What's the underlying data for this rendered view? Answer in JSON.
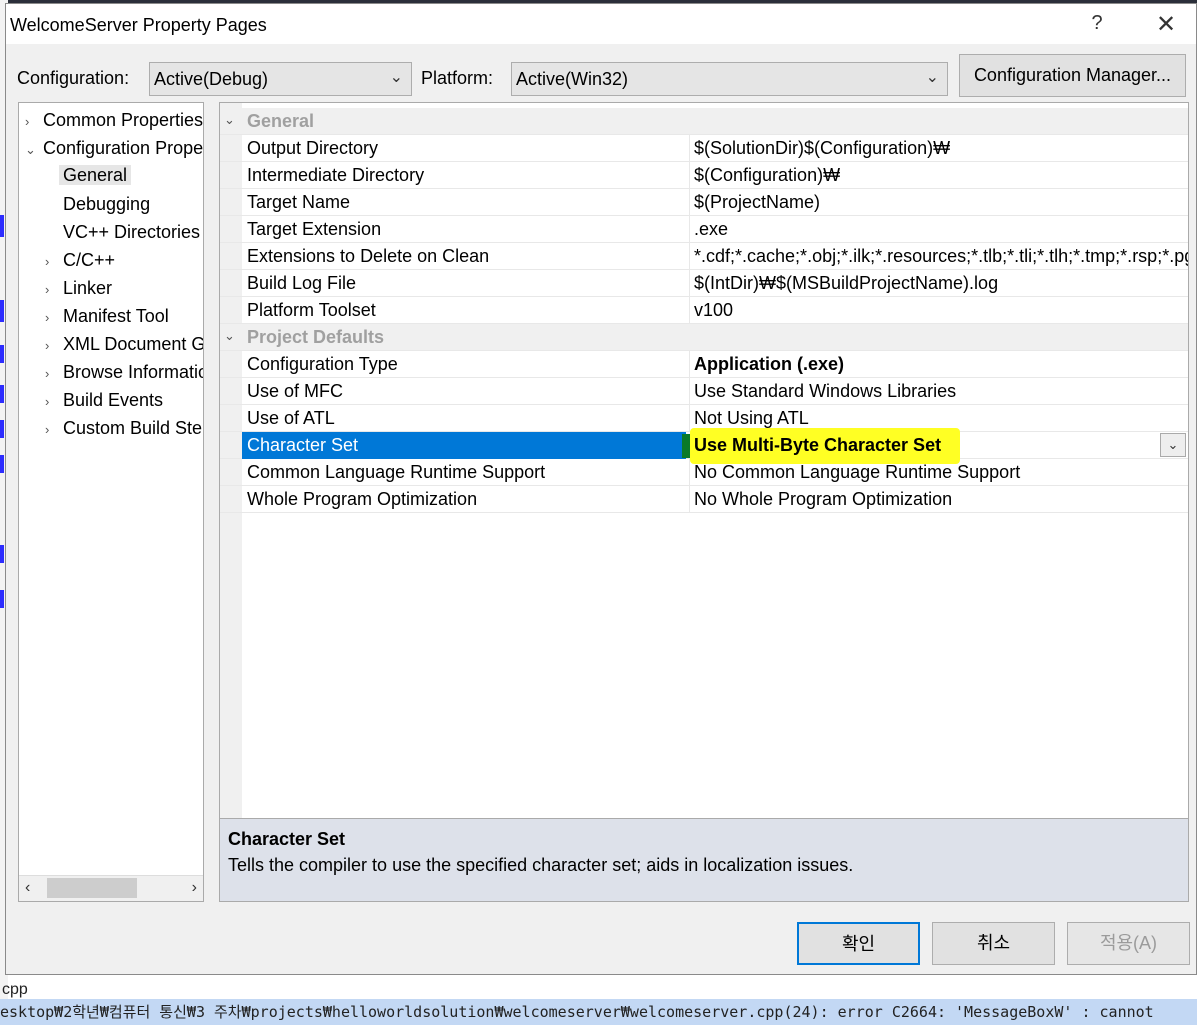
{
  "window": {
    "title": "WelcomeServer Property Pages",
    "help_label": "?",
    "close_label": "✕"
  },
  "toolbar": {
    "configuration_label": "Configuration:",
    "configuration_value": "Active(Debug)",
    "platform_label": "Platform:",
    "platform_value": "Active(Win32)",
    "config_manager_label": "Configuration Manager..."
  },
  "tree": {
    "items": [
      {
        "label": "Common Properties",
        "chevron": "›"
      },
      {
        "label": "Configuration Properties",
        "chevron": "⌄"
      },
      {
        "label": "General",
        "chevron": ""
      },
      {
        "label": "Debugging",
        "chevron": ""
      },
      {
        "label": "VC++ Directories",
        "chevron": ""
      },
      {
        "label": "C/C++",
        "chevron": "›"
      },
      {
        "label": "Linker",
        "chevron": "›"
      },
      {
        "label": "Manifest Tool",
        "chevron": "›"
      },
      {
        "label": "XML Document Generator",
        "chevron": "›"
      },
      {
        "label": "Browse Information",
        "chevron": "›"
      },
      {
        "label": "Build Events",
        "chevron": "›"
      },
      {
        "label": "Custom Build Step",
        "chevron": "›"
      }
    ],
    "scroll_left": "‹",
    "scroll_right": "›"
  },
  "grid": {
    "categories": {
      "general": "General",
      "project_defaults": "Project Defaults"
    },
    "general_rows": [
      {
        "name": "Output Directory",
        "value": "$(SolutionDir)$(Configuration)₩"
      },
      {
        "name": "Intermediate Directory",
        "value": "$(Configuration)₩"
      },
      {
        "name": "Target Name",
        "value": "$(ProjectName)"
      },
      {
        "name": "Target Extension",
        "value": ".exe"
      },
      {
        "name": "Extensions to Delete on Clean",
        "value": "*.cdf;*.cache;*.obj;*.ilk;*.resources;*.tlb;*.tli;*.tlh;*.tmp;*.rsp;*.pgc"
      },
      {
        "name": "Build Log File",
        "value": "$(IntDir)₩$(MSBuildProjectName).log"
      },
      {
        "name": "Platform Toolset",
        "value": "v100"
      }
    ],
    "defaults_rows": [
      {
        "name": "Configuration Type",
        "value": "Application (.exe)"
      },
      {
        "name": "Use of MFC",
        "value": "Use Standard Windows Libraries"
      },
      {
        "name": "Use of ATL",
        "value": "Not Using ATL"
      },
      {
        "name": "Character Set",
        "value": "Use Multi-Byte Character Set"
      },
      {
        "name": "Common Language Runtime Support",
        "value": "No Common Language Runtime Support"
      },
      {
        "name": "Whole Program Optimization",
        "value": "No Whole Program Optimization"
      }
    ],
    "dropdown_glyph": "⌄",
    "highlight_color": "#ffff24",
    "selection_color": "#0078d7"
  },
  "description": {
    "title": "Character Set",
    "text": "Tells the compiler to use the specified character set; aids in localization issues."
  },
  "buttons": {
    "ok": "확인",
    "cancel": "취소",
    "apply": "적용(A)"
  },
  "background": {
    "file_line": "cpp",
    "output_line": "esktop₩2학년₩컴퓨터 통신₩3 주차₩projects₩helloworldsolution₩welcomeserver₩welcomeserver.cpp(24): error C2664: 'MessageBoxW' : cannot"
  }
}
